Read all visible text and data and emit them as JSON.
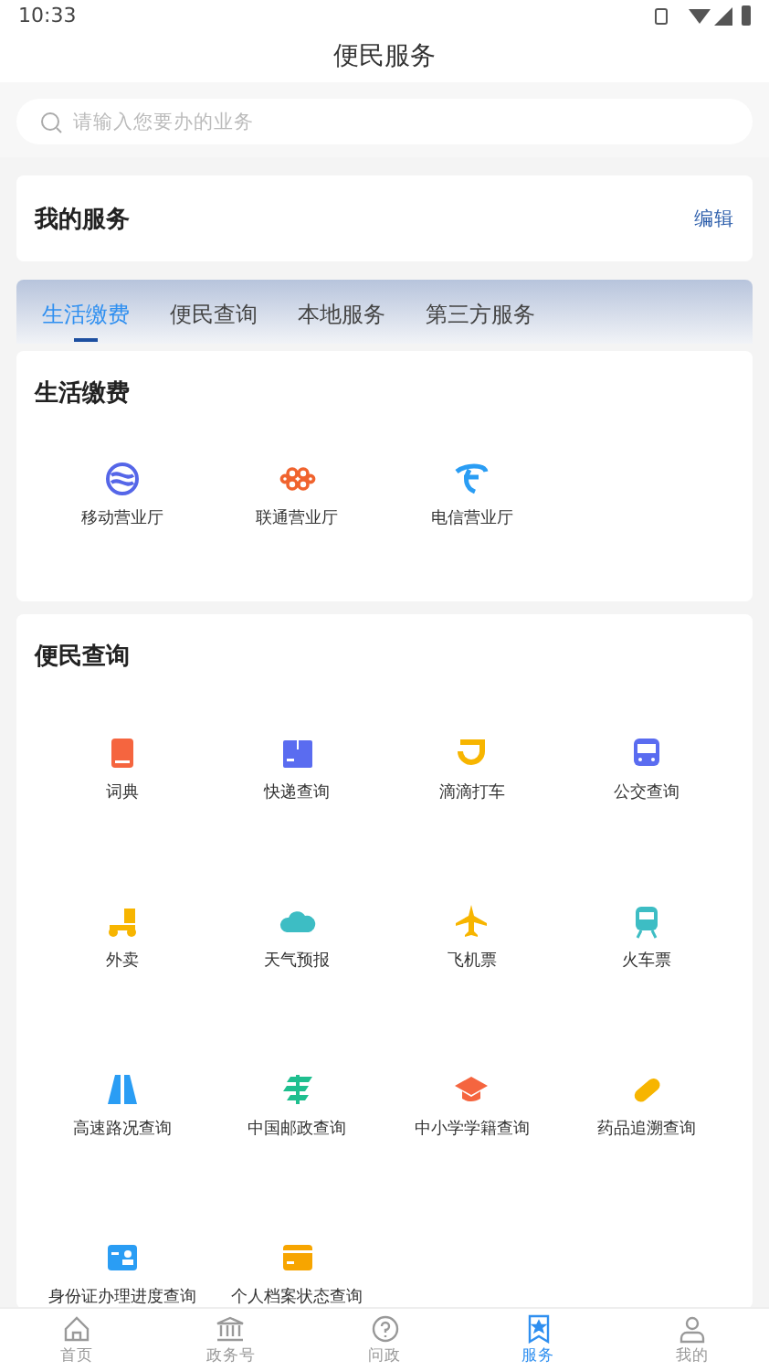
{
  "status_bar": {
    "time": "10:33"
  },
  "header": {
    "title": "便民服务"
  },
  "search": {
    "placeholder": "请输入您要办的业务"
  },
  "my_services": {
    "title": "我的服务",
    "edit": "编辑"
  },
  "tabs": [
    {
      "label": "生活缴费",
      "selected": true
    },
    {
      "label": "便民查询",
      "selected": false
    },
    {
      "label": "本地服务",
      "selected": false
    },
    {
      "label": "第三方服务",
      "selected": false
    }
  ],
  "sections": [
    {
      "title": "生活缴费",
      "items": [
        "移动营业厅",
        "联通营业厅",
        "电信营业厅"
      ]
    },
    {
      "title": "便民查询",
      "items": [
        "词典",
        "快递查询",
        "滴滴打车",
        "公交查询",
        "外卖",
        "天气预报",
        "飞机票",
        "火车票",
        "高速路况查询",
        "中国邮政查询",
        "中小学学籍查询",
        "药品追溯查询",
        "身份证办理进度查询",
        "个人档案状态查询"
      ]
    }
  ],
  "nav": [
    {
      "label": "首页",
      "selected": false
    },
    {
      "label": "政务号",
      "selected": false
    },
    {
      "label": "问政",
      "selected": false
    },
    {
      "label": "服务",
      "selected": true
    },
    {
      "label": "我的",
      "selected": false
    }
  ]
}
